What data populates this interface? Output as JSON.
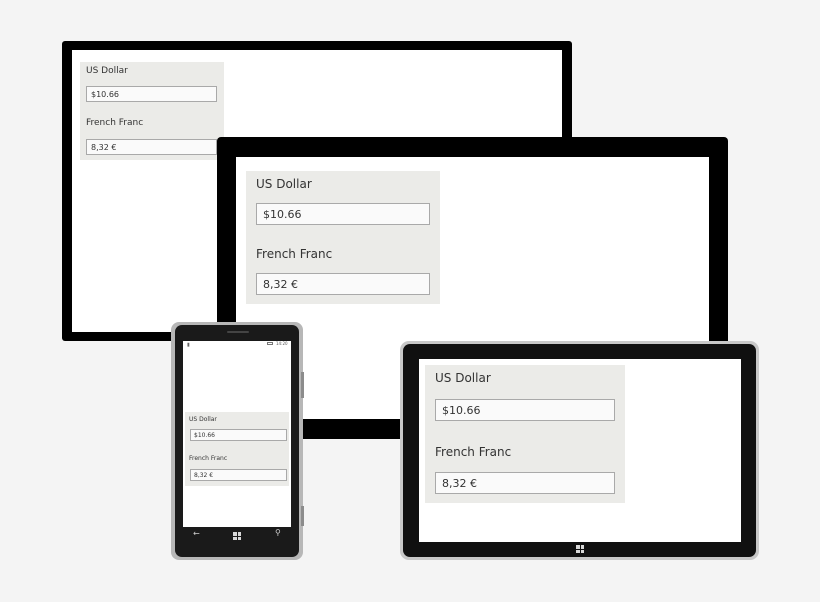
{
  "converter": {
    "us_label": "US Dollar",
    "us_value": "$10.66",
    "fr_label": "French Franc",
    "fr_value": "8,32 €"
  },
  "phone": {
    "status_time": "14:20"
  },
  "icons": {
    "back": "back-arrow-icon",
    "start": "windows-logo-icon",
    "search": "search-icon"
  },
  "colors": {
    "panel": "#ebebe8",
    "bezel": "#000000",
    "background": "#f4f4f4"
  }
}
